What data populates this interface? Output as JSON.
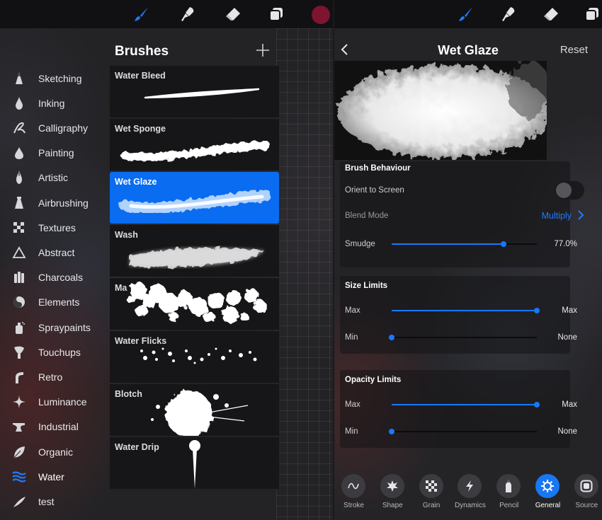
{
  "left_panel": {
    "title": "Brushes",
    "categories": [
      {
        "label": "Sketching",
        "icon": "pencil-tip-icon"
      },
      {
        "label": "Inking",
        "icon": "ink-drop-icon"
      },
      {
        "label": "Calligraphy",
        "icon": "calligraphy-stroke-icon"
      },
      {
        "label": "Painting",
        "icon": "paint-drop-icon"
      },
      {
        "label": "Artistic",
        "icon": "artistic-brush-icon"
      },
      {
        "label": "Airbrushing",
        "icon": "airbrush-icon"
      },
      {
        "label": "Textures",
        "icon": "checker-texture-icon"
      },
      {
        "label": "Abstract",
        "icon": "triangle-icon"
      },
      {
        "label": "Charcoals",
        "icon": "charcoal-sticks-icon"
      },
      {
        "label": "Elements",
        "icon": "yin-yang-icon"
      },
      {
        "label": "Spraypaints",
        "icon": "spray-can-icon"
      },
      {
        "label": "Touchups",
        "icon": "touchup-brush-icon"
      },
      {
        "label": "Retro",
        "icon": "retro-curve-icon"
      },
      {
        "label": "Luminance",
        "icon": "sparkle-icon"
      },
      {
        "label": "Industrial",
        "icon": "anvil-icon"
      },
      {
        "label": "Organic",
        "icon": "leaf-icon"
      },
      {
        "label": "Water",
        "icon": "water-waves-icon"
      },
      {
        "label": "test",
        "icon": "feather-icon"
      }
    ],
    "active_category": "Water",
    "brushes": [
      {
        "name": "Water Bleed"
      },
      {
        "name": "Wet Sponge"
      },
      {
        "name": "Wet Glaze"
      },
      {
        "name": "Wash"
      },
      {
        "name": "Ma"
      },
      {
        "name": "Water Flicks"
      },
      {
        "name": "Blotch"
      },
      {
        "name": "Water Drip"
      }
    ],
    "selected_brush": "Wet Glaze"
  },
  "right_panel": {
    "title": "Wet Glaze",
    "reset_label": "Reset",
    "brush_behaviour": {
      "title": "Brush Behaviour",
      "orient_label": "Orient to Screen",
      "orient_on": false,
      "blend_label": "Blend Mode",
      "blend_value": "Multiply",
      "smudge_label": "Smudge",
      "smudge_value": "77.0%",
      "smudge_fraction": 0.77
    },
    "size_limits": {
      "title": "Size Limits",
      "max_label": "Max",
      "max_value": "Max",
      "max_fraction": 1.0,
      "min_label": "Min",
      "min_value": "None",
      "min_fraction": 0.0
    },
    "opacity_limits": {
      "title": "Opacity Limits",
      "max_label": "Max",
      "max_value": "Max",
      "max_fraction": 1.0,
      "min_label": "Min",
      "min_value": "None",
      "min_fraction": 0.0
    },
    "tabs": [
      {
        "label": "Stroke",
        "icon": "stroke-wave-icon"
      },
      {
        "label": "Shape",
        "icon": "shape-splat-icon"
      },
      {
        "label": "Grain",
        "icon": "grain-checker-icon"
      },
      {
        "label": "Dynamics",
        "icon": "lightning-icon"
      },
      {
        "label": "Pencil",
        "icon": "pencil-icon"
      },
      {
        "label": "General",
        "icon": "gear-icon"
      },
      {
        "label": "Source",
        "icon": "source-square-icon"
      }
    ],
    "active_tab": "General"
  },
  "colors": {
    "accent": "#1778ff",
    "selected_brush_bg": "#0a6cf0",
    "current_color": "#7d1430"
  }
}
